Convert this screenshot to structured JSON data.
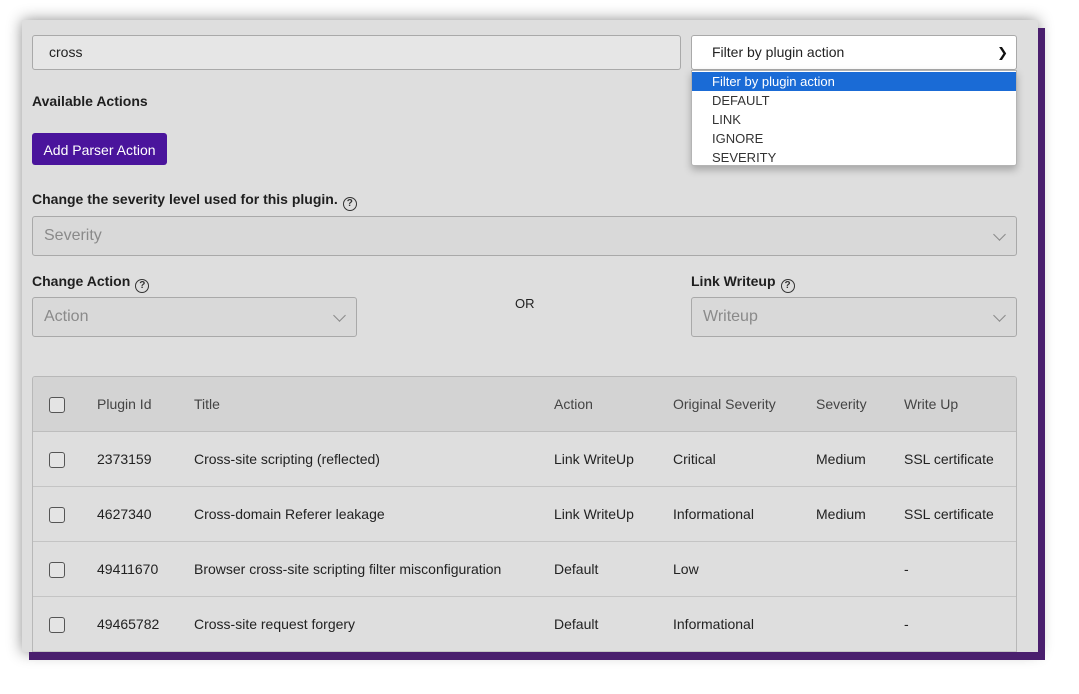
{
  "search": {
    "value": "cross"
  },
  "filter": {
    "selected": "Filter by plugin action",
    "options": [
      "Filter by plugin action",
      "DEFAULT",
      "LINK",
      "IGNORE",
      "SEVERITY"
    ]
  },
  "available_actions": {
    "heading": "Available Actions",
    "add_button": "Add Parser Action"
  },
  "severity_section": {
    "label": "Change the severity level used for this plugin.",
    "placeholder": "Severity"
  },
  "action_section": {
    "label": "Change Action",
    "placeholder": "Action"
  },
  "or_label": "OR",
  "writeup_section": {
    "label": "Link Writeup",
    "placeholder": "Writeup"
  },
  "table": {
    "headers": [
      "Plugin Id",
      "Title",
      "Action",
      "Original Severity",
      "Severity",
      "Write Up"
    ],
    "rows": [
      [
        "2373159",
        "Cross-site scripting (reflected)",
        "Link WriteUp",
        "Critical",
        "Medium",
        "SSL certificate"
      ],
      [
        "4627340",
        "Cross-domain Referer leakage",
        "Link WriteUp",
        "Informational",
        "Medium",
        "SSL certificate"
      ],
      [
        "49411670",
        "Browser cross-site scripting filter misconfiguration",
        "Default",
        "Low",
        "",
        "-"
      ],
      [
        "49465782",
        "Cross-site request forgery",
        "Default",
        "Informational",
        "",
        "-"
      ]
    ]
  }
}
